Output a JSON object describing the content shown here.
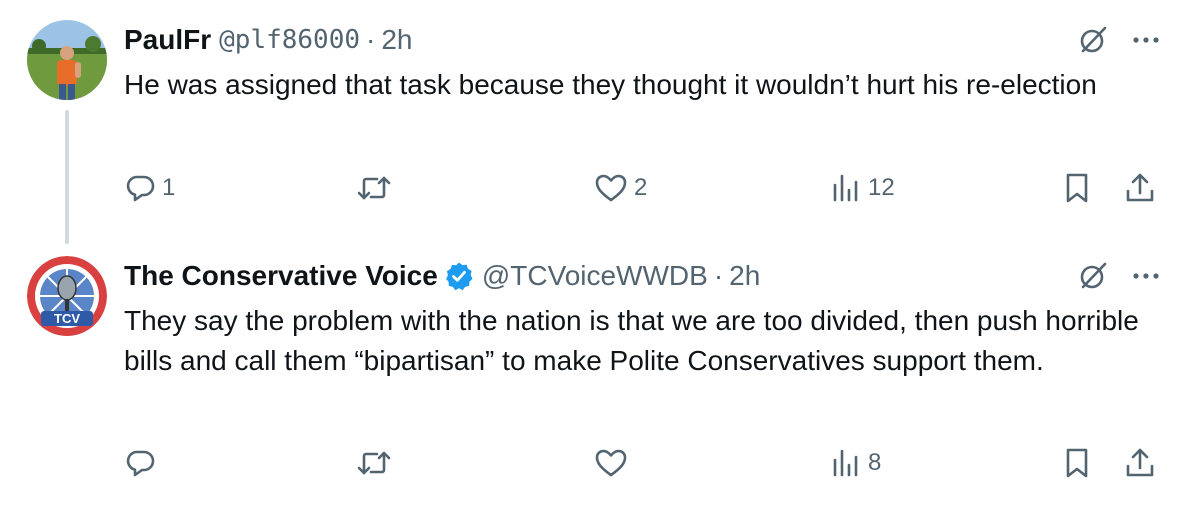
{
  "tweets": [
    {
      "display_name": "PaulFr",
      "handle": "@plf86000",
      "separator": "·",
      "time": "2h",
      "verified": false,
      "text": "He was assigned that task because they thought it wouldn’t hurt his re-election",
      "replies": "1",
      "retweets": "",
      "likes": "2",
      "views": "12"
    },
    {
      "display_name": "The Conservative Voice",
      "handle": "@TCVoiceWWDB",
      "separator": "·",
      "time": "2h",
      "verified": true,
      "avatar_badge_text": "TCV",
      "text": "They say the problem with the nation is that we are too divided, then push horrible bills and call them “bipartisan” to make Polite Conservatives support them.",
      "replies": "",
      "retweets": "",
      "likes": "",
      "views": "8"
    }
  ],
  "colors": {
    "text_primary": "#0f1419",
    "text_secondary": "#536471",
    "verified_blue": "#1d9bf0",
    "thread_line": "#cfd9de"
  },
  "icons": {
    "reply": "reply-icon",
    "retweet": "retweet-icon",
    "like": "like-icon",
    "views": "views-icon",
    "bookmark": "bookmark-icon",
    "share": "share-icon",
    "grok": "grok-icon",
    "more": "more-icon",
    "verified": "verified-badge-icon"
  }
}
